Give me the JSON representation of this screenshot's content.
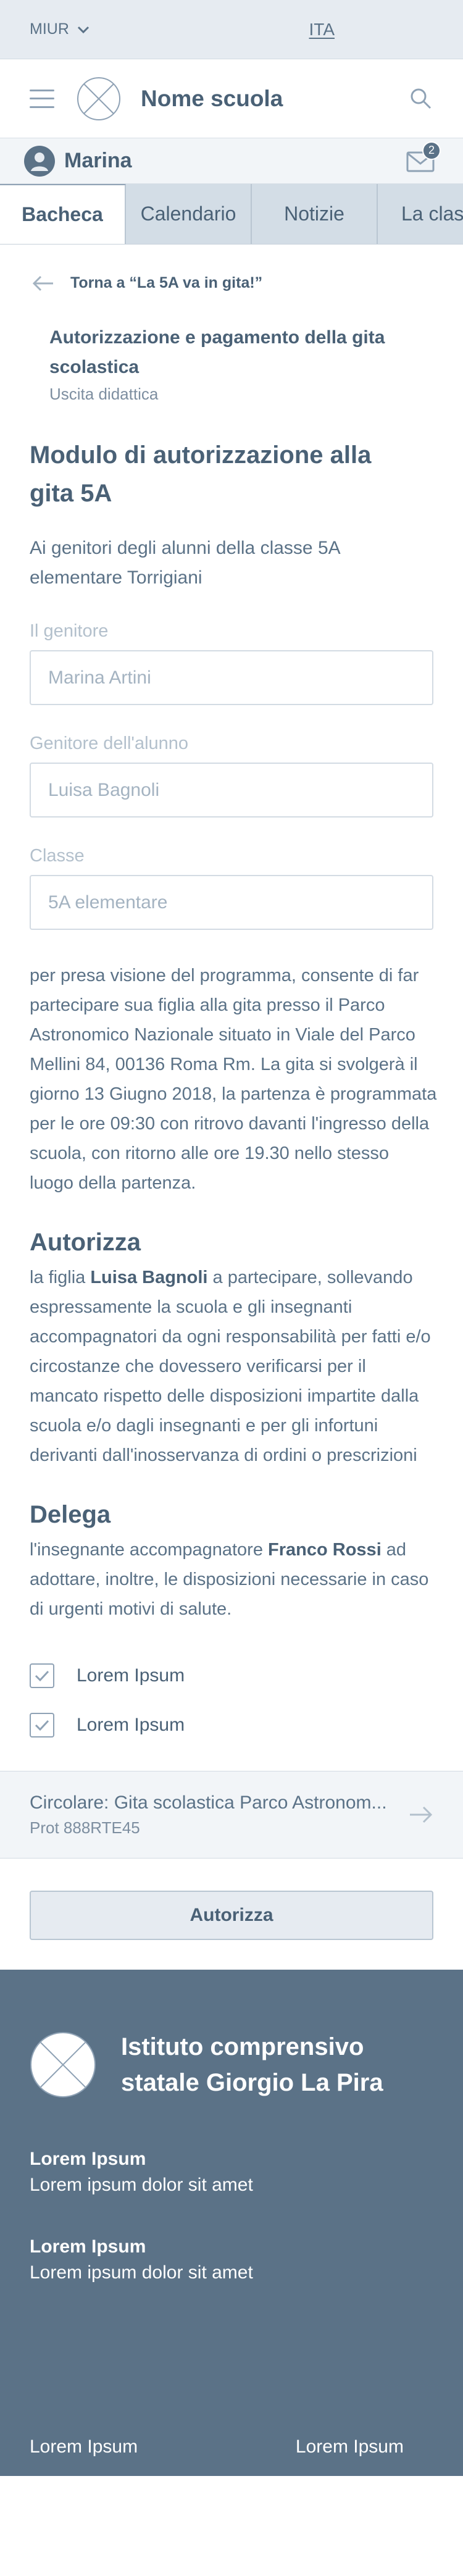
{
  "topbar": {
    "org": "MIUR",
    "lang": "ITA"
  },
  "header": {
    "school_name": "Nome scuola"
  },
  "user": {
    "name": "Marina",
    "notifications": "2"
  },
  "tabs": [
    {
      "label": "Bacheca",
      "active": true
    },
    {
      "label": "Calendario"
    },
    {
      "label": "Notizie"
    },
    {
      "label": "La classe"
    }
  ],
  "back": {
    "label": "Torna a “La 5A va in gita!”"
  },
  "doc": {
    "title": "Autorizzazione e pagamento della gita scolastica",
    "subtitle": "Uscita didattica"
  },
  "form": {
    "title": "Modulo di autorizzazione alla gita 5A",
    "intro": "Ai genitori degli alunni della classe 5A elementare Torrigiani",
    "fields": [
      {
        "label": "Il genitore",
        "value": "Marina Artini"
      },
      {
        "label": "Genitore dell'alunno",
        "value": "Luisa Bagnoli"
      },
      {
        "label": "Classe",
        "value": "5A elementare"
      }
    ],
    "paragraph": "per presa visione del programma, consente di far partecipare sua figlia alla gita presso il Parco Astronomico Nazionale situato in Viale del Parco Mellini 84, 00136 Roma Rm. La gita si svolgerà il giorno 13 Giugno 2018, la partenza è programmata per le ore 09:30 con ritrovo davanti l'ingresso della scuola, con ritorno alle ore 19.30 nello stesso luogo della partenza."
  },
  "autorizza": {
    "title": "Autorizza",
    "pre": "la figlia ",
    "name": "Luisa Bagnoli",
    "post": " a partecipare, sollevando espressamente la scuola e gli insegnanti accompagnatori da ogni responsabilità per fatti e/o circostanze che dovessero verificarsi per il mancato rispetto delle disposizioni impartite dalla scuola e/o dagli insegnanti e per gli infortuni derivanti dall'inosservanza di ordini o prescrizioni"
  },
  "delega": {
    "title": "Delega",
    "pre": "l'insegnante accompagnatore ",
    "name": "Franco Rossi",
    "post": " ad adottare, inoltre, le disposizioni necessarie in caso di urgenti motivi di salute."
  },
  "checks": [
    {
      "label": "Lorem Ipsum",
      "checked": true
    },
    {
      "label": "Lorem Ipsum",
      "checked": true
    }
  ],
  "attachment": {
    "title": "Circolare: Gita scolastica Parco Astronom...",
    "protocol": "Prot 888RTE45"
  },
  "submit_label": "Autorizza",
  "footer": {
    "school": "Istituto comprensivo statale Giorgio La Pira",
    "blocks": [
      {
        "title": "Lorem Ipsum",
        "text": "Lorem ipsum dolor sit amet"
      },
      {
        "title": "Lorem Ipsum",
        "text": "Lorem ipsum dolor sit amet"
      }
    ],
    "links": [
      "Lorem Ipsum",
      "Lorem Ipsum"
    ]
  },
  "colors": {
    "primary": "#5b7287",
    "text_dark": "#4a6176",
    "light_bg": "#e6ebf1"
  }
}
